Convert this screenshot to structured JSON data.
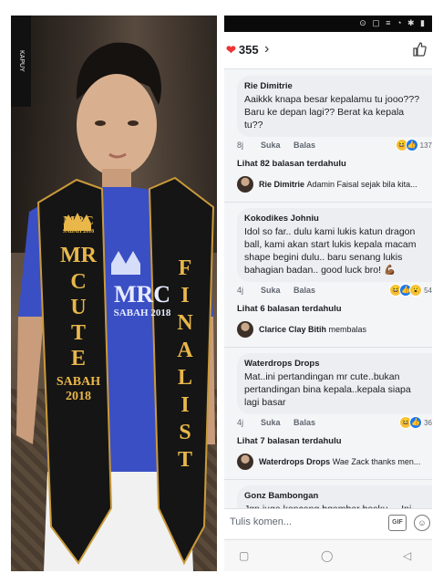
{
  "photo": {
    "watermark": "KAPUY",
    "sash_left": [
      "MRC",
      "SABAH 2018",
      "MR",
      "CUTE",
      "SABAH",
      "2018"
    ],
    "sash_right": [
      "FINALIST"
    ],
    "shirt_logo": [
      "MRC",
      "SABAH 2018"
    ]
  },
  "phone": {
    "reaction_count": "355",
    "comments": [
      {
        "author": "Rie Dimitrie",
        "text": "Aaikkk knapa besar kepalamu tu jooo??? Baru ke depan lagi?? Berat ka kepala tu??",
        "time": "8j",
        "like_label": "Suka",
        "reply_label": "Balas",
        "reactions": [
          "haha",
          "like"
        ],
        "reaction_count": "137",
        "more_replies": "Lihat 82 balasan terdahulu",
        "reply_author": "Rie Dimitrie",
        "reply_text": "Adamin Faisal sejak bila kita..."
      },
      {
        "author": "Kokodikes Johniu",
        "text": "Idol so far.. dulu kami lukis katun dragon ball, kami akan start lukis kepala macam shape begini dulu.. baru senang lukis bahagian badan.. good luck bro! 💪🏾",
        "time": "4j",
        "like_label": "Suka",
        "reply_label": "Balas",
        "reactions": [
          "haha",
          "like",
          "wow"
        ],
        "reaction_count": "54",
        "more_replies": "Lihat 6 balasan terdahulu",
        "reply_author": "Clarice Clay Bitih",
        "reply_text": "membalas"
      },
      {
        "author": "Waterdrops Drops",
        "text": "Mat..ini pertandingan mr cute..bukan pertandingan bina kepala..kepala siapa lagi basar",
        "time": "4j",
        "like_label": "Suka",
        "reply_label": "Balas",
        "reactions": [
          "haha",
          "like"
        ],
        "reaction_count": "36",
        "more_replies": "Lihat 7 balasan terdahulu",
        "reply_author": "Waterdrops Drops",
        "reply_text": "Wae Zack thanks men..."
      },
      {
        "author": "Gonz Bambongan",
        "text": "Jgn juga kencang bgambar bosku ... Ini"
      }
    ],
    "composer_placeholder": "Tulis komen...",
    "gif_label": "GIF"
  },
  "colors": {
    "shirt": "#3a4fc4",
    "sash": "#151515",
    "sash_text": "#e9b74a",
    "fb_blue": "#1877f2"
  }
}
